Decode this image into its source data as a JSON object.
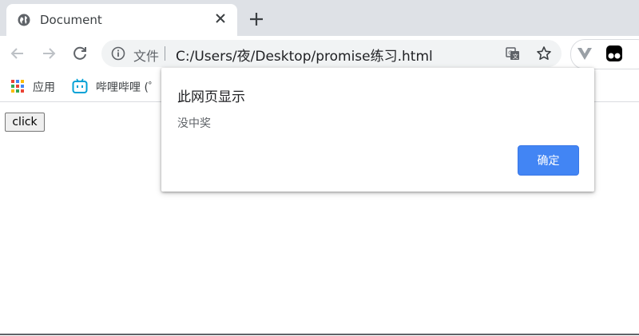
{
  "tab": {
    "title": "Document"
  },
  "omnibox": {
    "scheme_label": "文件",
    "url": "C:/Users/夜/Desktop/promise练习.html"
  },
  "bookmarks": [
    {
      "label": "应用",
      "icon": "apps-grid-icon"
    },
    {
      "label": "哔哩哔哩 (゜",
      "icon": "bilibili-icon"
    }
  ],
  "page": {
    "button_label": "click"
  },
  "dialog": {
    "title": "此网页显示",
    "message": "没中奖",
    "ok_label": "确定"
  },
  "colors": {
    "accent": "#4285f4",
    "tabstrip": "#dee1e6",
    "omnibox": "#f1f3f4",
    "bilibili": "#00a1d6"
  }
}
